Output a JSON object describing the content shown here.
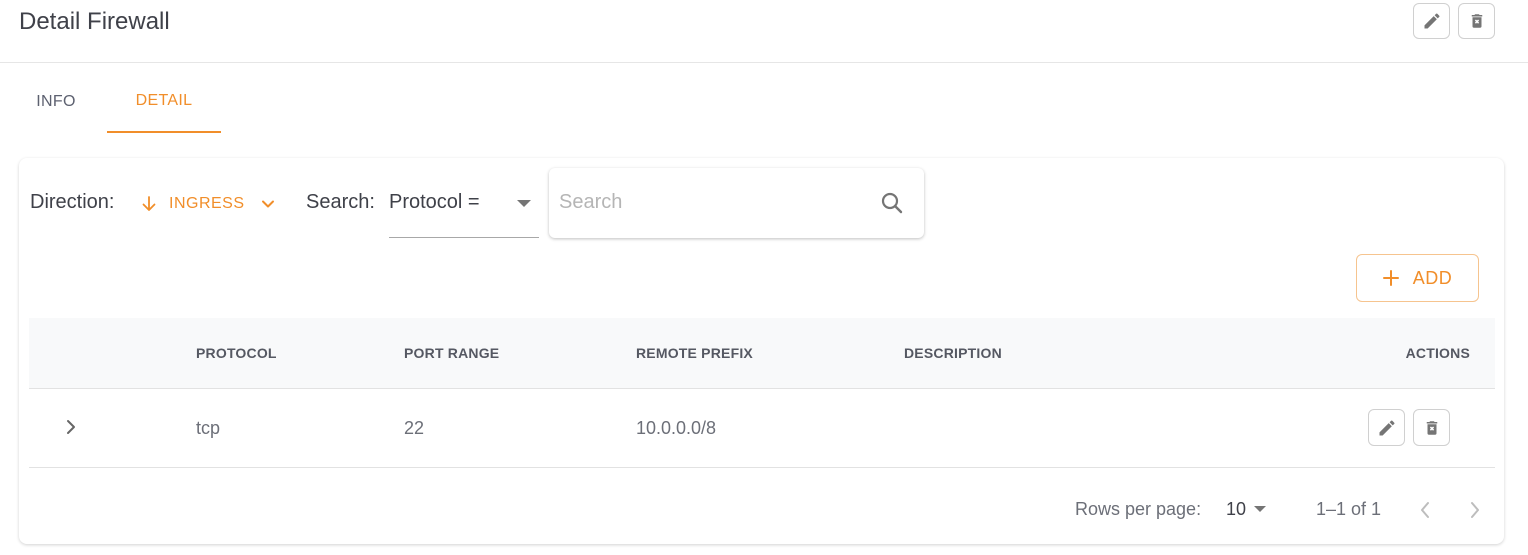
{
  "header": {
    "title": "Detail Firewall",
    "edit_icon": "pencil-icon",
    "delete_icon": "trash-x-icon"
  },
  "tabs": [
    {
      "label": "INFO",
      "active": false
    },
    {
      "label": "DETAIL",
      "active": true
    }
  ],
  "filters": {
    "direction_label": "Direction:",
    "direction_value": "INGRESS",
    "direction_icon": "arrow-down-icon",
    "search_label": "Search:",
    "search_field_value": "Protocol =",
    "search_placeholder": "Search",
    "search_value": ""
  },
  "add_button": {
    "label": "ADD",
    "icon": "plus-icon"
  },
  "table": {
    "columns": [
      "",
      "PROTOCOL",
      "PORT RANGE",
      "REMOTE PREFIX",
      "DESCRIPTION",
      "ACTIONS"
    ],
    "rows": [
      {
        "protocol": "tcp",
        "port_range": "22",
        "remote_prefix": "10.0.0.0/8",
        "description": ""
      }
    ]
  },
  "pagination": {
    "rows_per_page_label": "Rows per page:",
    "rows_per_page_value": "10",
    "range_text": "1–1 of 1"
  },
  "colors": {
    "accent": "#f18e2a",
    "accent_border": "#f6c48f",
    "text_dark": "#3f4149",
    "icon_gray": "#757575",
    "table_header_bg": "#f8f9fa"
  }
}
